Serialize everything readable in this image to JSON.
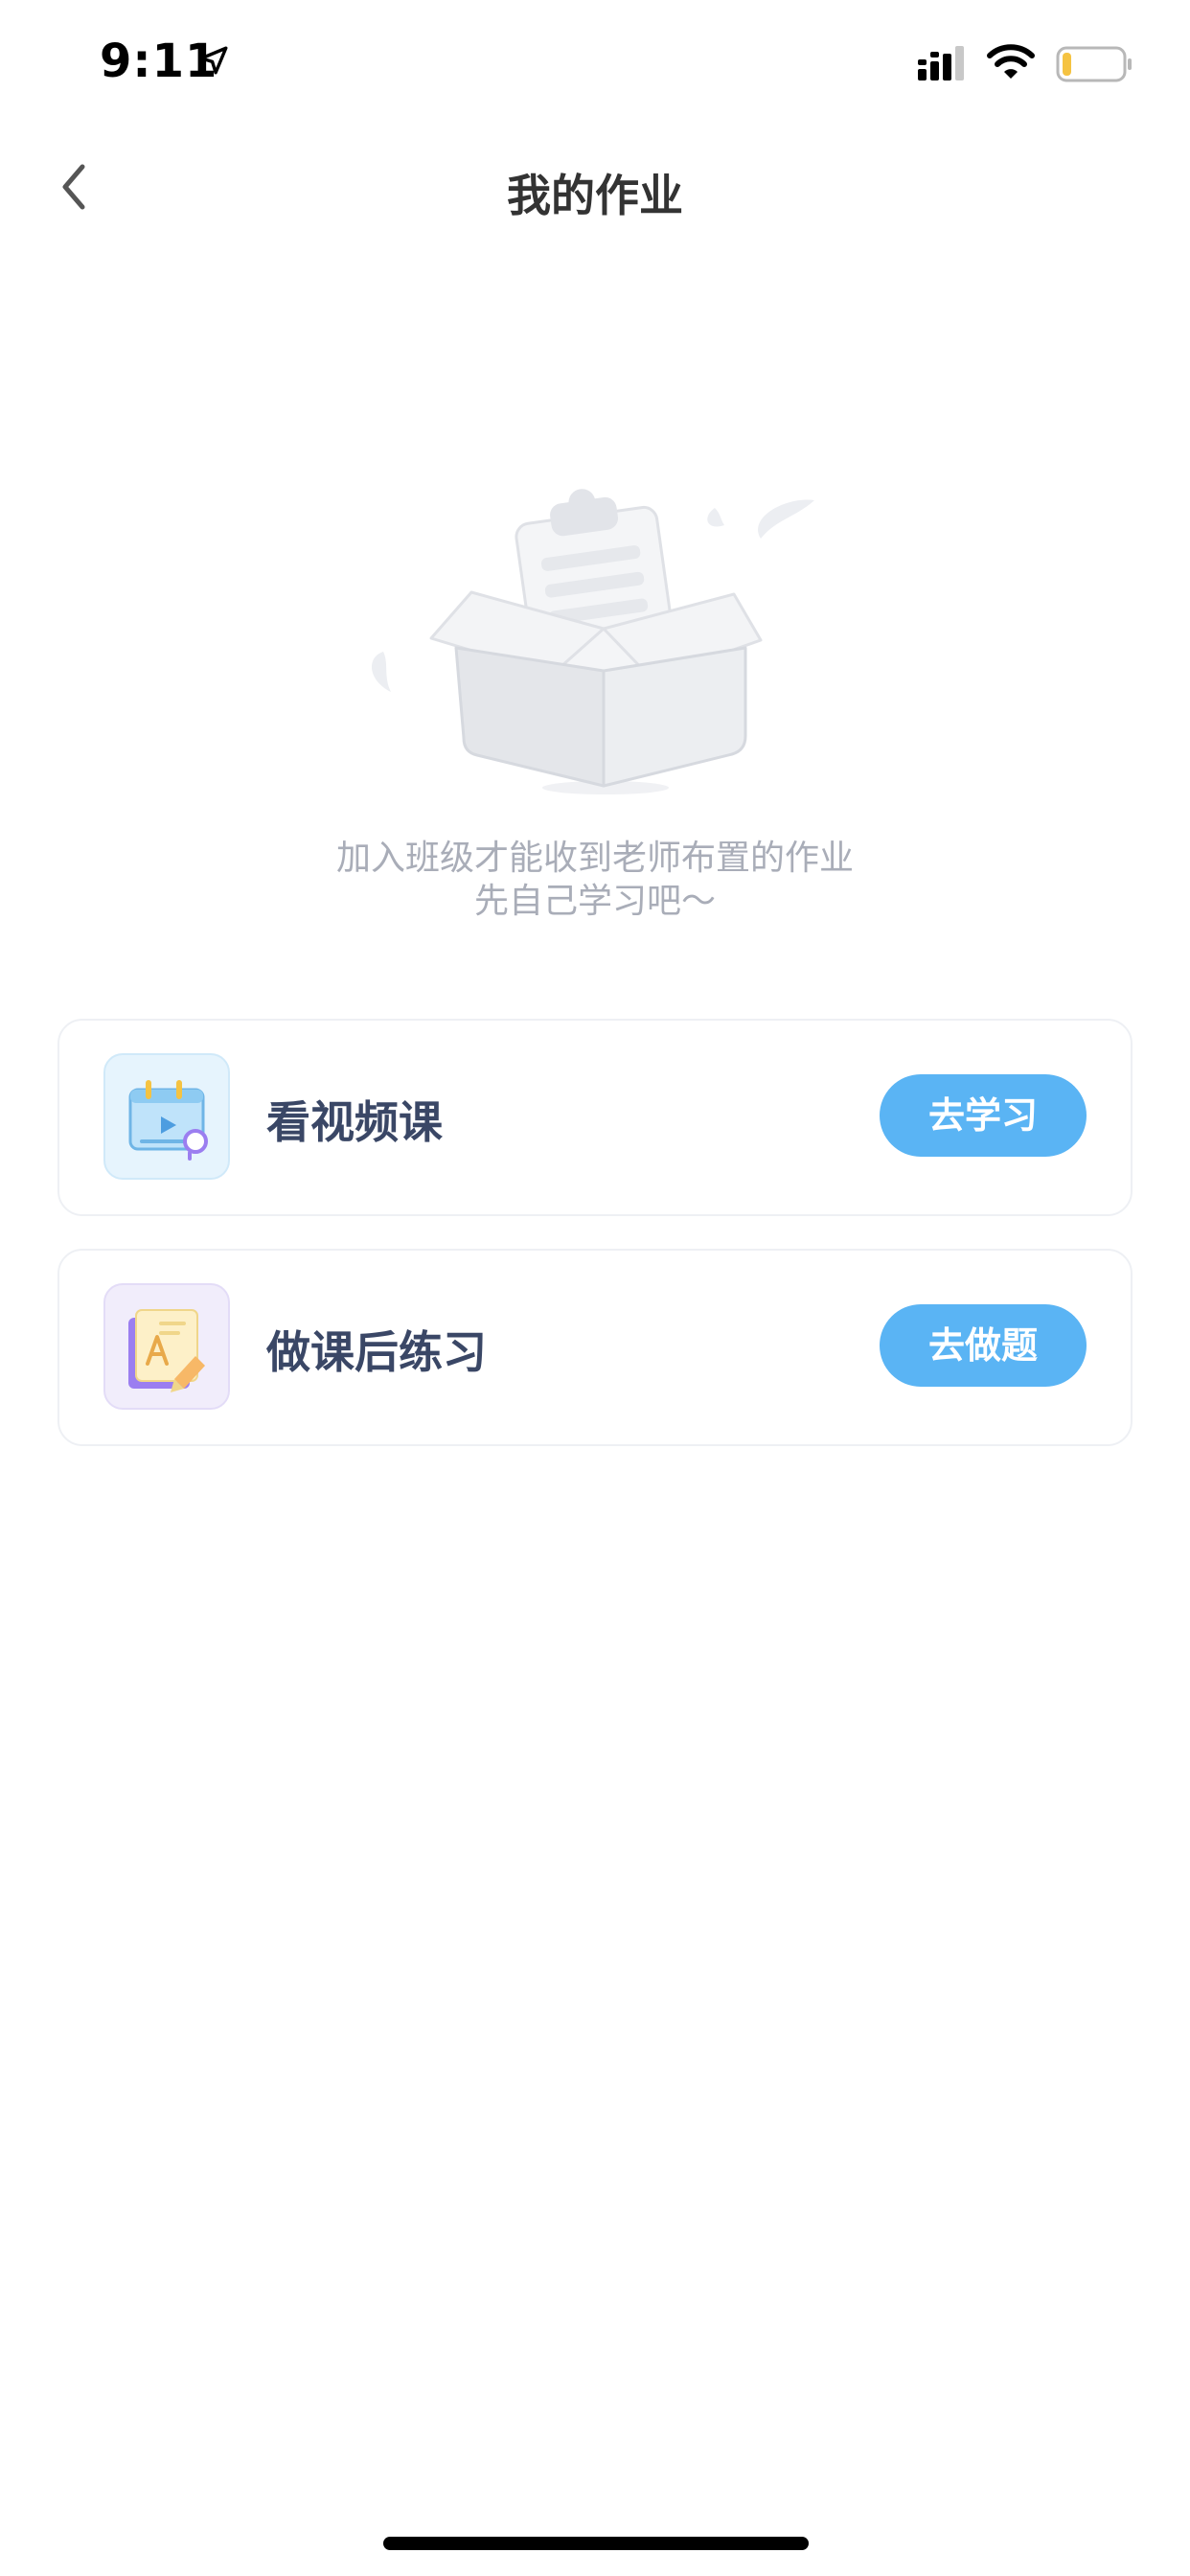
{
  "status_bar": {
    "time": "9:11",
    "icons": [
      "location-arrow-icon",
      "cellular-signal-icon",
      "wifi-icon",
      "battery-icon"
    ],
    "battery_level": 0.15,
    "battery_color": "#f5c342"
  },
  "nav": {
    "title": "我的作业",
    "back_icon": "chevron-left-icon"
  },
  "empty_state": {
    "illustration": "empty-box-clipboard-icon",
    "line1": "加入班级才能收到老师布置的作业",
    "line2": "先自己学习吧～"
  },
  "cards": [
    {
      "icon": "video-calendar-icon",
      "title": "看视频课",
      "button_label": "去学习"
    },
    {
      "icon": "practice-paper-icon",
      "title": "做课后练习",
      "button_label": "去做题"
    }
  ],
  "colors": {
    "accent": "#5ab4f4",
    "card_title": "#3a4766",
    "muted_text": "#a9adb8"
  }
}
